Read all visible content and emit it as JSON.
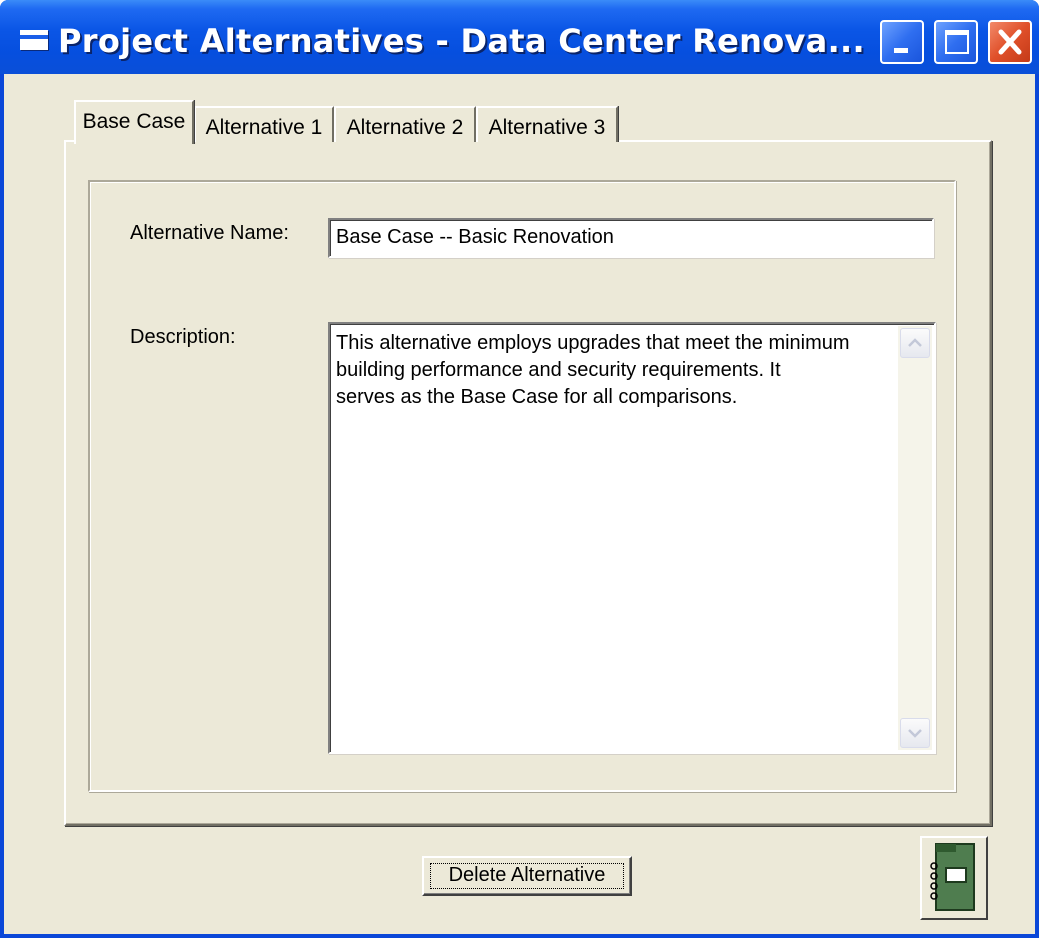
{
  "window": {
    "title": "Project Alternatives - Data Center Renova...",
    "controls": [
      "minimize-icon",
      "maximize-icon",
      "close-icon"
    ],
    "title_color": "#ffffff",
    "titlebar_color": "#0a4fd8"
  },
  "tabs": [
    {
      "label": "Base Case",
      "active": true
    },
    {
      "label": "Alternative 1",
      "active": false
    },
    {
      "label": "Alternative 2",
      "active": false
    },
    {
      "label": "Alternative 3",
      "active": false
    }
  ],
  "form": {
    "name_label": "Alternative Name:",
    "name_value": "Base Case -- Basic Renovation",
    "description_label": "Description:",
    "description_value": "This alternative employs upgrades that meet the minimum\nbuilding performance and security requirements. It\nserves as the Base Case for all comparisons."
  },
  "actions": {
    "delete_label": "Delete Alternative",
    "notebook_icon": "notebook-icon"
  },
  "colors": {
    "dialog_bg": "#ece9d8",
    "notebook_green": "#4f7d4f"
  }
}
